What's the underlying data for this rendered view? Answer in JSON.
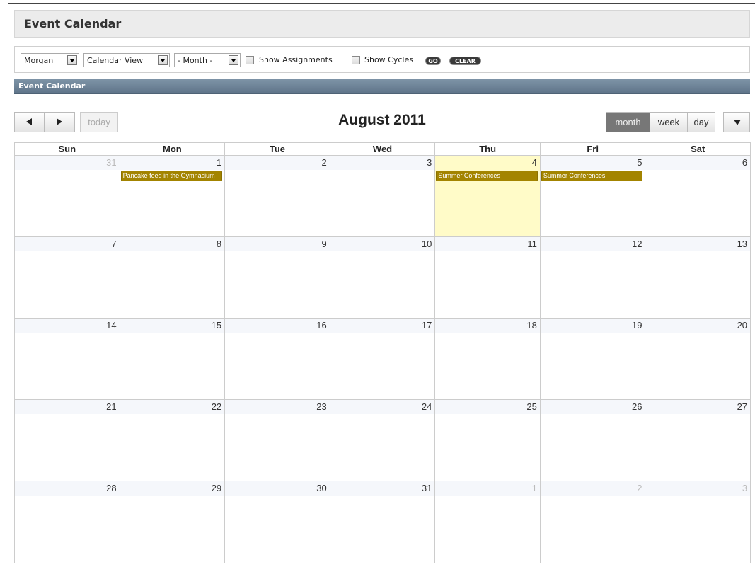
{
  "header": {
    "title": "Event Calendar"
  },
  "toolbar": {
    "user_select": "Morgan",
    "view_select": "Calendar View",
    "month_select": "- Month -",
    "show_assignments": "Show Assignments",
    "show_cycles": "Show Cycles",
    "go_label": "GO",
    "clear_label": "CLEAR"
  },
  "section": {
    "title": "Event Calendar"
  },
  "calendar": {
    "title": "August 2011",
    "today_label": "today",
    "views": {
      "month": "month",
      "week": "week",
      "day": "day"
    },
    "day_headers": [
      "Sun",
      "Mon",
      "Tue",
      "Wed",
      "Thu",
      "Fri",
      "Sat"
    ],
    "weeks": [
      [
        {
          "day": "31",
          "other": true
        },
        {
          "day": "1",
          "events": [
            "Pancake feed in the Gymnasium"
          ]
        },
        {
          "day": "2"
        },
        {
          "day": "3"
        },
        {
          "day": "4",
          "today": true,
          "events": [
            "Summer Conferences"
          ]
        },
        {
          "day": "5",
          "events": [
            "Summer Conferences"
          ]
        },
        {
          "day": "6"
        }
      ],
      [
        {
          "day": "7"
        },
        {
          "day": "8"
        },
        {
          "day": "9"
        },
        {
          "day": "10"
        },
        {
          "day": "11"
        },
        {
          "day": "12"
        },
        {
          "day": "13"
        }
      ],
      [
        {
          "day": "14"
        },
        {
          "day": "15"
        },
        {
          "day": "16"
        },
        {
          "day": "17"
        },
        {
          "day": "18"
        },
        {
          "day": "19"
        },
        {
          "day": "20"
        }
      ],
      [
        {
          "day": "21"
        },
        {
          "day": "22"
        },
        {
          "day": "23"
        },
        {
          "day": "24"
        },
        {
          "day": "25"
        },
        {
          "day": "26"
        },
        {
          "day": "27"
        }
      ],
      [
        {
          "day": "28"
        },
        {
          "day": "29"
        },
        {
          "day": "30"
        },
        {
          "day": "31"
        },
        {
          "day": "1",
          "other": true
        },
        {
          "day": "2",
          "other": true
        },
        {
          "day": "3",
          "other": true
        }
      ]
    ]
  },
  "colors": {
    "event": "#a38400",
    "today_highlight": "#fffbc8",
    "section_bar": "#6f8599"
  }
}
